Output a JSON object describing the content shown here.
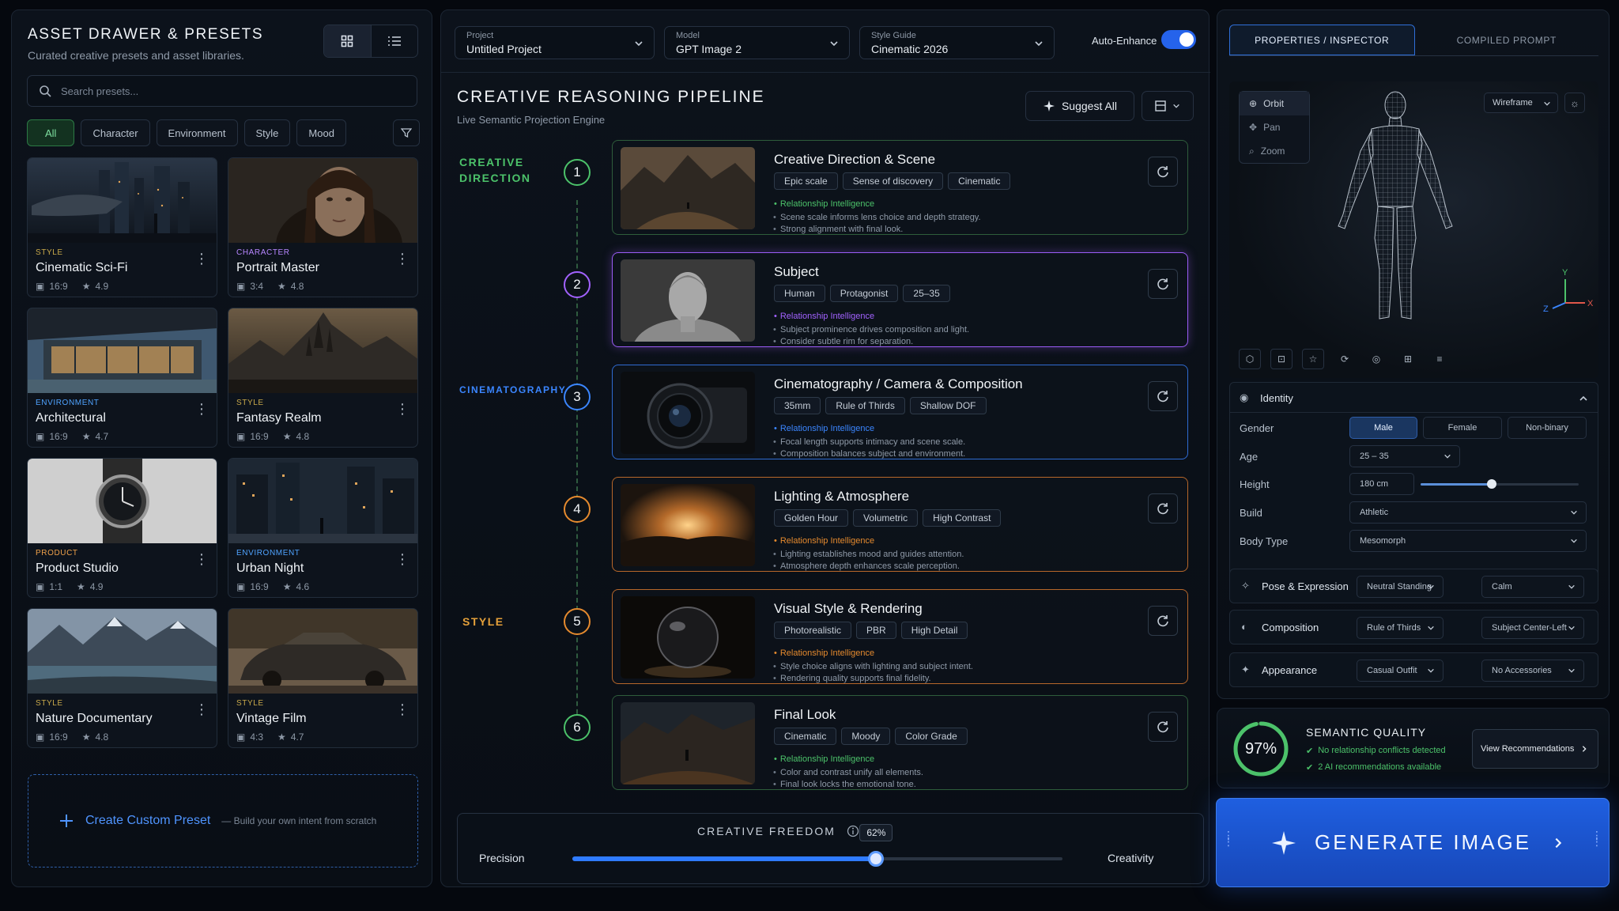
{
  "left": {
    "title": "ASSET DRAWER & PRESETS",
    "subtitle": "Curated creative presets and asset libraries.",
    "search_placeholder": "Search presets...",
    "filters": [
      "All",
      "Character",
      "Environment",
      "Style",
      "Mood"
    ],
    "cards": [
      {
        "category": "STYLE",
        "category_color": "#c9a94a",
        "name": "Cinematic Sci-Fi",
        "ratio": "16:9",
        "rating": "4.9"
      },
      {
        "category": "CHARACTER",
        "category_color": "#b786ff",
        "name": "Portrait Master",
        "ratio": "3:4",
        "rating": "4.8"
      },
      {
        "category": "ENVIRONMENT",
        "category_color": "#4fa3ff",
        "name": "Architectural",
        "ratio": "16:9",
        "rating": "4.7"
      },
      {
        "category": "STYLE",
        "category_color": "#c9a94a",
        "name": "Fantasy Realm",
        "ratio": "16:9",
        "rating": "4.8"
      },
      {
        "category": "PRODUCT",
        "category_color": "#f0a24a",
        "name": "Product Studio",
        "ratio": "1:1",
        "rating": "4.9"
      },
      {
        "category": "ENVIRONMENT",
        "category_color": "#4fa3ff",
        "name": "Urban Night",
        "ratio": "16:9",
        "rating": "4.6"
      },
      {
        "category": "STYLE",
        "category_color": "#c9a94a",
        "name": "Nature Documentary",
        "ratio": "16:9",
        "rating": "4.8"
      },
      {
        "category": "STYLE",
        "category_color": "#c9a94a",
        "name": "Vintage Film",
        "ratio": "4:3",
        "rating": "4.7"
      }
    ],
    "create": {
      "label": "Create Custom Preset",
      "hint": "— Build your own intent from scratch"
    }
  },
  "center": {
    "project": {
      "label": "Project",
      "value": "Untitled Project"
    },
    "model": {
      "label": "Model",
      "value": "GPT Image 2"
    },
    "style_guide": {
      "label": "Style Guide",
      "value": "Cinematic 2026"
    },
    "auto_enhance": {
      "label": "Auto-Enhance",
      "on": true
    },
    "title": "CREATIVE REASONING PIPELINE",
    "subtitle": "Live Semantic Projection Engine",
    "suggest_all": "Suggest All",
    "sections": {
      "creative_direction": "CREATIVE DIRECTION",
      "cinematography": "CINEMATOGRAPHY",
      "style": "STYLE"
    },
    "steps": [
      {
        "num": "1",
        "color": "#4cc26a",
        "title": "Creative Direction & Scene",
        "tags": [
          "Epic scale",
          "Sense of discovery",
          "Cinematic"
        ],
        "ri": "Relationship Intelligence",
        "l1": "Scene scale informs lens choice and depth strategy.",
        "l2": "Strong alignment with final look."
      },
      {
        "num": "2",
        "color": "#a262ff",
        "title": "Subject",
        "tags": [
          "Human",
          "Protagonist",
          "25–35"
        ],
        "ri": "Relationship Intelligence",
        "l1": "Subject prominence drives composition and light.",
        "l2": "Consider subtle rim for separation."
      },
      {
        "num": "3",
        "color": "#3b86ff",
        "title": "Cinematography / Camera & Composition",
        "tags": [
          "35mm",
          "Rule of Thirds",
          "Shallow DOF"
        ],
        "ri": "Relationship Intelligence",
        "l1": "Focal length supports intimacy and scene scale.",
        "l2": "Composition balances subject and environment."
      },
      {
        "num": "4",
        "color": "#e58a2e",
        "title": "Lighting & Atmosphere",
        "tags": [
          "Golden Hour",
          "Volumetric",
          "High Contrast"
        ],
        "ri": "Relationship Intelligence",
        "l1": "Lighting establishes mood and guides attention.",
        "l2": "Atmosphere depth enhances scale perception."
      },
      {
        "num": "5",
        "color": "#e58a2e",
        "title": "Visual Style & Rendering",
        "tags": [
          "Photorealistic",
          "PBR",
          "High Detail"
        ],
        "ri": "Relationship Intelligence",
        "l1": "Style choice aligns with lighting and subject intent.",
        "l2": "Rendering quality supports final fidelity."
      },
      {
        "num": "6",
        "color": "#4cc26a",
        "title": "Final Look",
        "tags": [
          "Cinematic",
          "Moody",
          "Color Grade"
        ],
        "ri": "Relationship Intelligence",
        "l1": "Color and contrast unify all elements.",
        "l2": "Final look locks the emotional tone."
      }
    ],
    "freedom": {
      "label": "CREATIVE FREEDOM",
      "value": 62,
      "value_text": "62%",
      "left": "Precision",
      "right": "Creativity"
    }
  },
  "right": {
    "tabs": [
      "PROPERTIES / INSPECTOR",
      "COMPILED PROMPT"
    ],
    "viewport": {
      "tools": [
        "Orbit",
        "Pan",
        "Zoom"
      ],
      "mode": "Wireframe",
      "axes": {
        "y": "Y",
        "z": "Z",
        "x": "X"
      }
    },
    "identity": {
      "title": "Identity",
      "gender_label": "Gender",
      "gender_options": [
        "Male",
        "Female",
        "Non-binary"
      ],
      "age_label": "Age",
      "age_value": "25 – 35",
      "height_label": "Height",
      "height_value": "180 cm",
      "height_level": 0.45,
      "build_label": "Build",
      "build_value": "Athletic",
      "body_label": "Body Type",
      "body_value": "Mesomorph"
    },
    "pose": {
      "title": "Pose & Expression",
      "a": "Neutral Standing",
      "b": "Calm"
    },
    "composition": {
      "title": "Composition",
      "a": "Rule of Thirds",
      "b": "Subject Center-Left"
    },
    "appearance": {
      "title": "Appearance",
      "a": "Casual Outfit",
      "b": "No Accessories"
    },
    "quality": {
      "value": 97,
      "value_text": "97%",
      "title": "SEMANTIC QUALITY",
      "line1": "No relationship conflicts detected",
      "line2": "2 AI recommendations available",
      "button": "View Recommendations"
    },
    "generate": "GENERATE IMAGE"
  }
}
